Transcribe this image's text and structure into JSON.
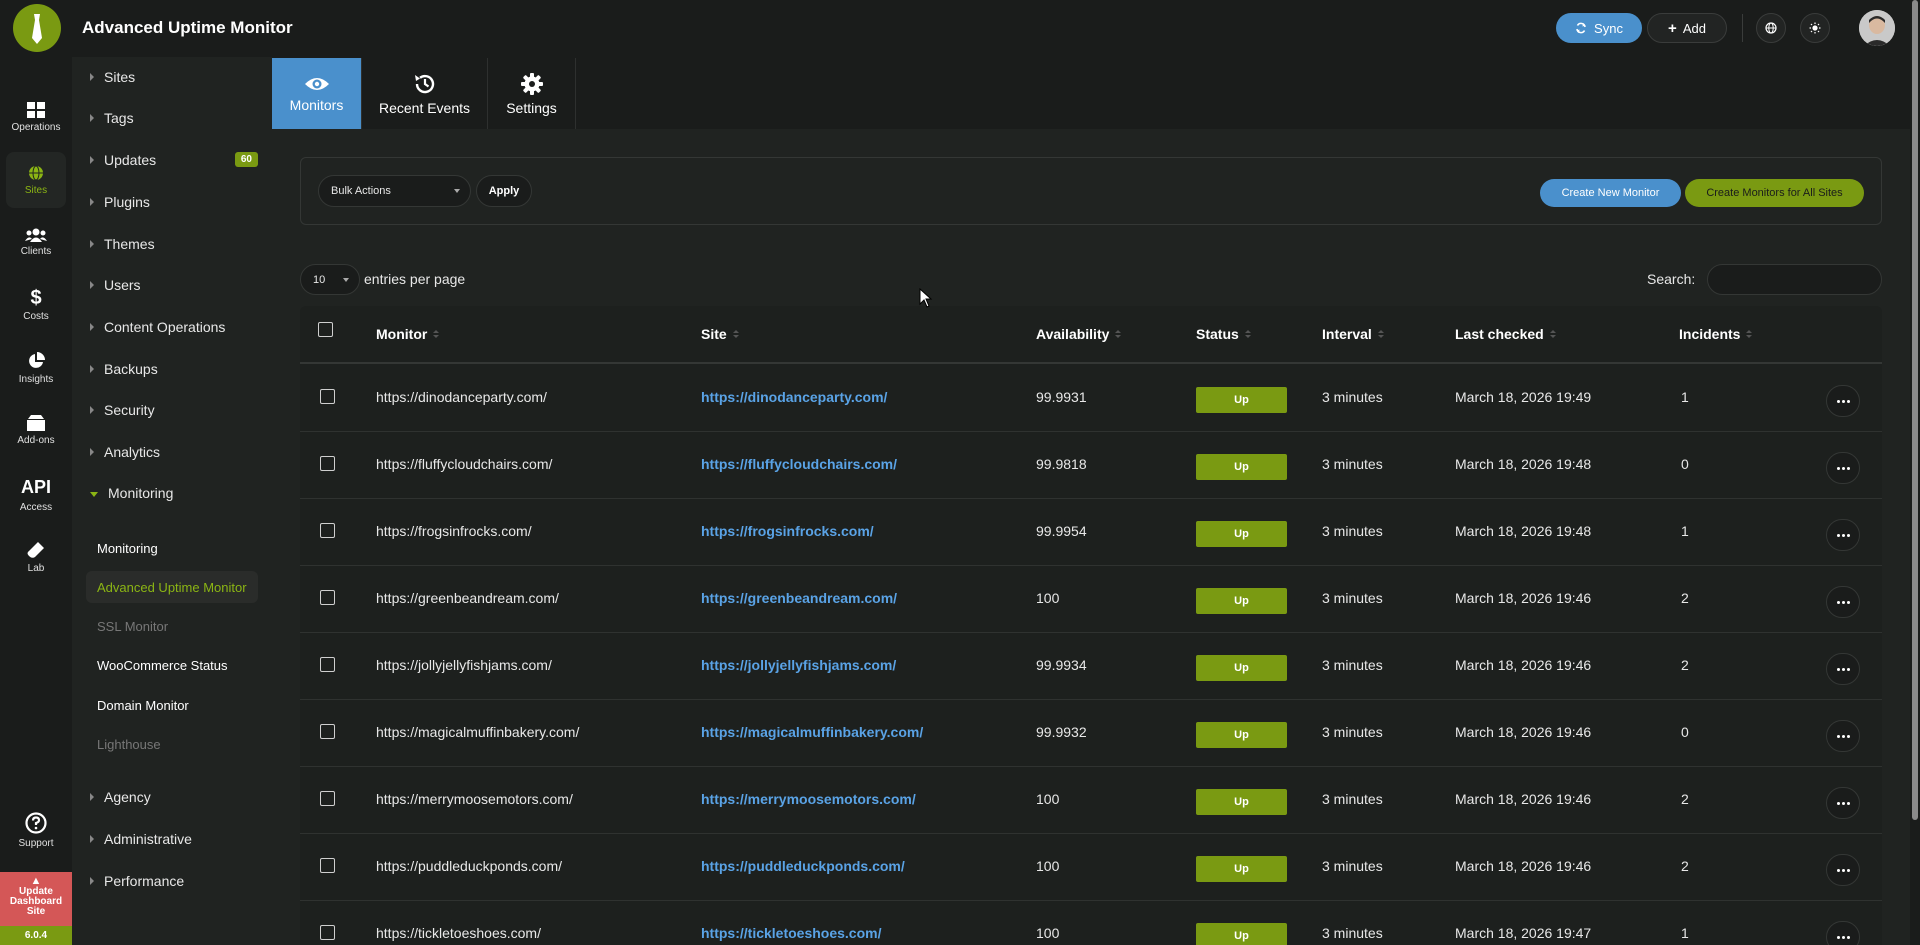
{
  "app": {
    "title": "Advanced Uptime Monitor",
    "sync_label": "Sync",
    "add_label": "Add"
  },
  "rail": {
    "items": [
      {
        "label": "Operations",
        "icon": "grid-icon"
      },
      {
        "label": "Sites",
        "icon": "globe-icon"
      },
      {
        "label": "Clients",
        "icon": "users-icon"
      },
      {
        "label": "Costs",
        "icon": "dollar-icon"
      },
      {
        "label": "Insights",
        "icon": "pie-chart-icon"
      },
      {
        "label": "Add-ons",
        "icon": "box-icon"
      },
      {
        "label": "Access",
        "icon": "api-icon",
        "title": "API"
      },
      {
        "label": "Lab",
        "icon": "flask-icon"
      }
    ],
    "support_label": "Support",
    "update_label": "Update Dashboard Site",
    "version": "6.0.4"
  },
  "sidebar": {
    "items": [
      {
        "label": "Sites"
      },
      {
        "label": "Tags"
      },
      {
        "label": "Updates",
        "badge": "60"
      },
      {
        "label": "Plugins"
      },
      {
        "label": "Themes"
      },
      {
        "label": "Users"
      },
      {
        "label": "Content Operations"
      },
      {
        "label": "Backups"
      },
      {
        "label": "Security"
      },
      {
        "label": "Analytics"
      },
      {
        "label": "Monitoring"
      }
    ],
    "monitoring_sub": [
      {
        "label": "Monitoring"
      },
      {
        "label": "Advanced Uptime Monitor"
      },
      {
        "label": "SSL Monitor"
      },
      {
        "label": "WooCommerce Status"
      },
      {
        "label": "Domain Monitor"
      },
      {
        "label": "Lighthouse"
      }
    ],
    "bottom_items": [
      {
        "label": "Agency"
      },
      {
        "label": "Administrative"
      },
      {
        "label": "Performance"
      }
    ]
  },
  "tabs": [
    {
      "label": "Monitors",
      "icon": "eye-icon"
    },
    {
      "label": "Recent Events",
      "icon": "history-icon"
    },
    {
      "label": "Settings",
      "icon": "gear-icon"
    }
  ],
  "toolbar": {
    "bulk_actions": "Bulk Actions",
    "apply_label": "Apply",
    "create_new_monitor": "Create New Monitor",
    "create_all_sites": "Create Monitors for All Sites",
    "entries_value": "10",
    "entries_label": "entries per page",
    "search_label": "Search:",
    "search_value": ""
  },
  "table": {
    "headers": [
      "Monitor",
      "Site",
      "Availability",
      "Status",
      "Interval",
      "Last checked",
      "Incidents"
    ],
    "rows": [
      {
        "monitor": "https://dinodanceparty.com/",
        "site": "https://dinodanceparty.com/",
        "availability": "99.9931",
        "status": "Up",
        "interval": "3 minutes",
        "last_checked": "March 18, 2026 19:49",
        "incidents": "1"
      },
      {
        "monitor": "https://fluffycloudchairs.com/",
        "site": "https://fluffycloudchairs.com/",
        "availability": "99.9818",
        "status": "Up",
        "interval": "3 minutes",
        "last_checked": "March 18, 2026 19:48",
        "incidents": "0"
      },
      {
        "monitor": "https://frogsinfrocks.com/",
        "site": "https://frogsinfrocks.com/",
        "availability": "99.9954",
        "status": "Up",
        "interval": "3 minutes",
        "last_checked": "March 18, 2026 19:48",
        "incidents": "1"
      },
      {
        "monitor": "https://greenbeandream.com/",
        "site": "https://greenbeandream.com/",
        "availability": "100",
        "status": "Up",
        "interval": "3 minutes",
        "last_checked": "March 18, 2026 19:46",
        "incidents": "2"
      },
      {
        "monitor": "https://jollyjellyfishjams.com/",
        "site": "https://jollyjellyfishjams.com/",
        "availability": "99.9934",
        "status": "Up",
        "interval": "3 minutes",
        "last_checked": "March 18, 2026 19:46",
        "incidents": "2"
      },
      {
        "monitor": "https://magicalmuffinbakery.com/",
        "site": "https://magicalmuffinbakery.com/",
        "availability": "99.9932",
        "status": "Up",
        "interval": "3 minutes",
        "last_checked": "March 18, 2026 19:46",
        "incidents": "0"
      },
      {
        "monitor": "https://merrymoosemotors.com/",
        "site": "https://merrymoosemotors.com/",
        "availability": "100",
        "status": "Up",
        "interval": "3 minutes",
        "last_checked": "March 18, 2026 19:46",
        "incidents": "2"
      },
      {
        "monitor": "https://puddleduckponds.com/",
        "site": "https://puddleduckponds.com/",
        "availability": "100",
        "status": "Up",
        "interval": "3 minutes",
        "last_checked": "March 18, 2026 19:46",
        "incidents": "2"
      },
      {
        "monitor": "https://tickletoeshoes.com/",
        "site": "https://tickletoeshoes.com/",
        "availability": "100",
        "status": "Up",
        "interval": "3 minutes",
        "last_checked": "March 18, 2026 19:47",
        "incidents": "1"
      }
    ]
  },
  "colors": {
    "accent_green": "#7a9a12",
    "accent_blue": "#4a90cc",
    "link_blue": "#5aa3e6",
    "warning_red": "#d45757"
  }
}
